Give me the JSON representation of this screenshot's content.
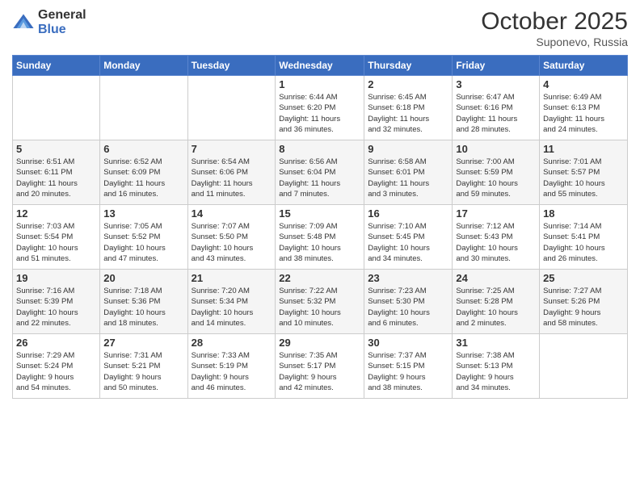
{
  "logo": {
    "general": "General",
    "blue": "Blue"
  },
  "header": {
    "month": "October 2025",
    "location": "Suponevo, Russia"
  },
  "weekdays": [
    "Sunday",
    "Monday",
    "Tuesday",
    "Wednesday",
    "Thursday",
    "Friday",
    "Saturday"
  ],
  "weeks": [
    [
      {
        "day": "",
        "info": ""
      },
      {
        "day": "",
        "info": ""
      },
      {
        "day": "",
        "info": ""
      },
      {
        "day": "1",
        "info": "Sunrise: 6:44 AM\nSunset: 6:20 PM\nDaylight: 11 hours\nand 36 minutes."
      },
      {
        "day": "2",
        "info": "Sunrise: 6:45 AM\nSunset: 6:18 PM\nDaylight: 11 hours\nand 32 minutes."
      },
      {
        "day": "3",
        "info": "Sunrise: 6:47 AM\nSunset: 6:16 PM\nDaylight: 11 hours\nand 28 minutes."
      },
      {
        "day": "4",
        "info": "Sunrise: 6:49 AM\nSunset: 6:13 PM\nDaylight: 11 hours\nand 24 minutes."
      }
    ],
    [
      {
        "day": "5",
        "info": "Sunrise: 6:51 AM\nSunset: 6:11 PM\nDaylight: 11 hours\nand 20 minutes."
      },
      {
        "day": "6",
        "info": "Sunrise: 6:52 AM\nSunset: 6:09 PM\nDaylight: 11 hours\nand 16 minutes."
      },
      {
        "day": "7",
        "info": "Sunrise: 6:54 AM\nSunset: 6:06 PM\nDaylight: 11 hours\nand 11 minutes."
      },
      {
        "day": "8",
        "info": "Sunrise: 6:56 AM\nSunset: 6:04 PM\nDaylight: 11 hours\nand 7 minutes."
      },
      {
        "day": "9",
        "info": "Sunrise: 6:58 AM\nSunset: 6:01 PM\nDaylight: 11 hours\nand 3 minutes."
      },
      {
        "day": "10",
        "info": "Sunrise: 7:00 AM\nSunset: 5:59 PM\nDaylight: 10 hours\nand 59 minutes."
      },
      {
        "day": "11",
        "info": "Sunrise: 7:01 AM\nSunset: 5:57 PM\nDaylight: 10 hours\nand 55 minutes."
      }
    ],
    [
      {
        "day": "12",
        "info": "Sunrise: 7:03 AM\nSunset: 5:54 PM\nDaylight: 10 hours\nand 51 minutes."
      },
      {
        "day": "13",
        "info": "Sunrise: 7:05 AM\nSunset: 5:52 PM\nDaylight: 10 hours\nand 47 minutes."
      },
      {
        "day": "14",
        "info": "Sunrise: 7:07 AM\nSunset: 5:50 PM\nDaylight: 10 hours\nand 43 minutes."
      },
      {
        "day": "15",
        "info": "Sunrise: 7:09 AM\nSunset: 5:48 PM\nDaylight: 10 hours\nand 38 minutes."
      },
      {
        "day": "16",
        "info": "Sunrise: 7:10 AM\nSunset: 5:45 PM\nDaylight: 10 hours\nand 34 minutes."
      },
      {
        "day": "17",
        "info": "Sunrise: 7:12 AM\nSunset: 5:43 PM\nDaylight: 10 hours\nand 30 minutes."
      },
      {
        "day": "18",
        "info": "Sunrise: 7:14 AM\nSunset: 5:41 PM\nDaylight: 10 hours\nand 26 minutes."
      }
    ],
    [
      {
        "day": "19",
        "info": "Sunrise: 7:16 AM\nSunset: 5:39 PM\nDaylight: 10 hours\nand 22 minutes."
      },
      {
        "day": "20",
        "info": "Sunrise: 7:18 AM\nSunset: 5:36 PM\nDaylight: 10 hours\nand 18 minutes."
      },
      {
        "day": "21",
        "info": "Sunrise: 7:20 AM\nSunset: 5:34 PM\nDaylight: 10 hours\nand 14 minutes."
      },
      {
        "day": "22",
        "info": "Sunrise: 7:22 AM\nSunset: 5:32 PM\nDaylight: 10 hours\nand 10 minutes."
      },
      {
        "day": "23",
        "info": "Sunrise: 7:23 AM\nSunset: 5:30 PM\nDaylight: 10 hours\nand 6 minutes."
      },
      {
        "day": "24",
        "info": "Sunrise: 7:25 AM\nSunset: 5:28 PM\nDaylight: 10 hours\nand 2 minutes."
      },
      {
        "day": "25",
        "info": "Sunrise: 7:27 AM\nSunset: 5:26 PM\nDaylight: 9 hours\nand 58 minutes."
      }
    ],
    [
      {
        "day": "26",
        "info": "Sunrise: 7:29 AM\nSunset: 5:24 PM\nDaylight: 9 hours\nand 54 minutes."
      },
      {
        "day": "27",
        "info": "Sunrise: 7:31 AM\nSunset: 5:21 PM\nDaylight: 9 hours\nand 50 minutes."
      },
      {
        "day": "28",
        "info": "Sunrise: 7:33 AM\nSunset: 5:19 PM\nDaylight: 9 hours\nand 46 minutes."
      },
      {
        "day": "29",
        "info": "Sunrise: 7:35 AM\nSunset: 5:17 PM\nDaylight: 9 hours\nand 42 minutes."
      },
      {
        "day": "30",
        "info": "Sunrise: 7:37 AM\nSunset: 5:15 PM\nDaylight: 9 hours\nand 38 minutes."
      },
      {
        "day": "31",
        "info": "Sunrise: 7:38 AM\nSunset: 5:13 PM\nDaylight: 9 hours\nand 34 minutes."
      },
      {
        "day": "",
        "info": ""
      }
    ]
  ]
}
